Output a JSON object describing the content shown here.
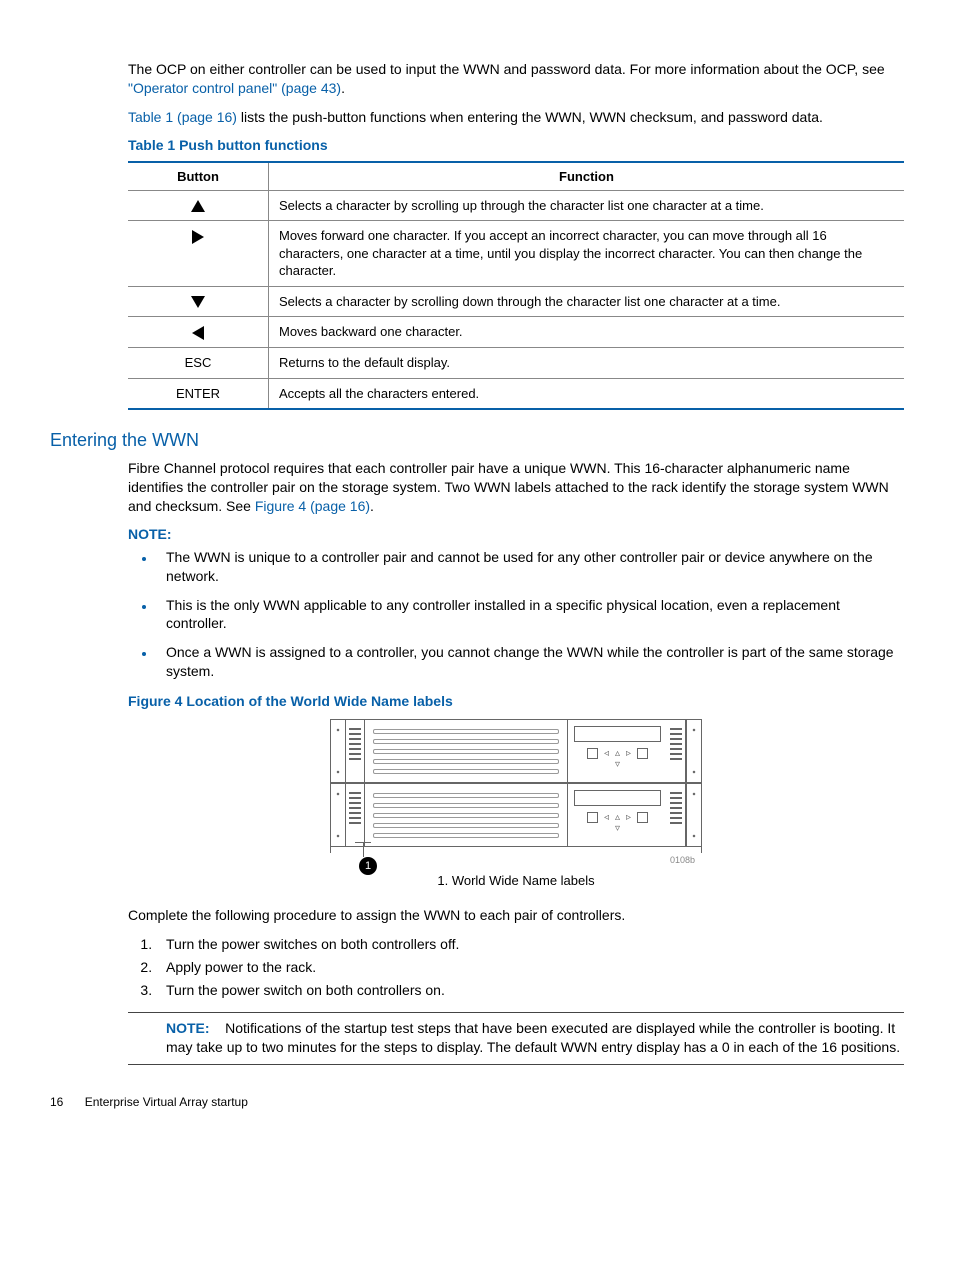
{
  "intro": {
    "p1a": "The OCP on either controller can be used to input the WWN and password data. For more information about the OCP, see ",
    "p1link": "\"Operator control panel\" (page 43)",
    "p1b": ".",
    "p2link": "Table 1 (page 16)",
    "p2a": " lists the push-button functions when entering the WWN, WWN checksum, and password data."
  },
  "table1": {
    "title": "Table 1 Push button functions",
    "head_button": "Button",
    "head_function": "Function",
    "rows": [
      {
        "icon": "up",
        "text": "Selects a character by scrolling up through the character list one character at a time."
      },
      {
        "icon": "right",
        "text": "Moves forward one character. If you accept an incorrect character, you can move through all 16 characters, one character at a time, until you display the incorrect character. You can then change the character."
      },
      {
        "icon": "down",
        "text": "Selects a character by scrolling down through the character list one character at a time."
      },
      {
        "icon": "left",
        "text": "Moves backward one character."
      },
      {
        "icon": "ESC",
        "text": "Returns to the default display."
      },
      {
        "icon": "ENTER",
        "text": "Accepts all the characters entered."
      }
    ]
  },
  "section": {
    "title": "Entering the WWN",
    "p1a": "Fibre Channel protocol requires that each controller pair have a unique WWN. This 16-character alphanumeric name identifies the controller pair on the storage system. Two WWN labels attached to the rack identify the storage system WWN and checksum. See ",
    "p1link": "Figure 4 (page 16)",
    "p1b": ".",
    "note_title": "NOTE:",
    "notes": [
      "The WWN is unique to a controller pair and cannot be used for any other controller pair or device anywhere on the network.",
      "This is the only WWN applicable to any controller installed in a specific physical location, even a replacement controller.",
      "Once a WWN is assigned to a controller, you cannot change the WWN while the controller is part of the same storage system."
    ]
  },
  "figure": {
    "title": "Figure 4 Location of the World Wide Name labels",
    "callout": "1",
    "idlabel": "0108b",
    "caption": "1. World Wide Name labels"
  },
  "proc": {
    "intro": "Complete the following procedure to assign the WWN to each pair of controllers.",
    "steps": [
      "Turn the power switches on both controllers off.",
      "Apply power to the rack.",
      "Turn the power switch on both controllers on."
    ],
    "note_label": "NOTE:",
    "note_text": "Notifications of the startup test steps that have been executed are displayed while the controller is booting. It may take up to two minutes for the steps to display. The default WWN entry display has a 0 in each of the 16 positions."
  },
  "footer": {
    "page": "16",
    "title": "Enterprise Virtual Array startup"
  }
}
